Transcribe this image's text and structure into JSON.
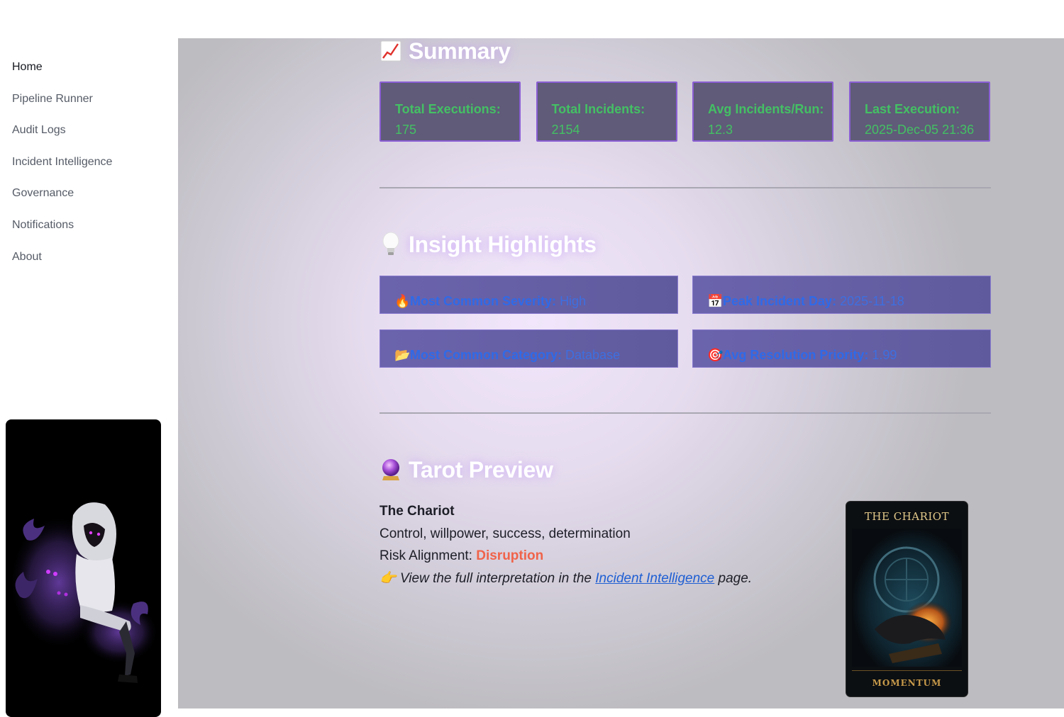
{
  "sidebar": {
    "items": [
      {
        "label": "Home",
        "active": true
      },
      {
        "label": "Pipeline Runner"
      },
      {
        "label": "Audit Logs"
      },
      {
        "label": "Incident Intelligence"
      },
      {
        "label": "Governance"
      },
      {
        "label": "Notifications"
      },
      {
        "label": "About"
      }
    ]
  },
  "summary": {
    "title": "Summary",
    "icon": "chart-increasing-icon",
    "metrics": [
      {
        "label": "Total Executions:",
        "value": "175"
      },
      {
        "label": "Total Incidents:",
        "value": "2154"
      },
      {
        "label": "Avg Incidents/Run:",
        "value": "12.3"
      },
      {
        "label": "Last Execution:",
        "value": "2025-Dec-05 21:36"
      }
    ]
  },
  "insights": {
    "title": "Insight Highlights",
    "icon": "light-bulb-icon",
    "items": [
      {
        "icon": "fire-icon",
        "key": "Most Common Severity:",
        "value": "High"
      },
      {
        "icon": "calendar-icon",
        "key": "Peak Incident Day:",
        "value": "2025-11-18"
      },
      {
        "icon": "folder-icon",
        "key": "Most Common Category:",
        "value": "Database"
      },
      {
        "icon": "target-icon",
        "key": "Avg Resolution Priority:",
        "value": "1.99"
      }
    ]
  },
  "tarot": {
    "title": "Tarot Preview",
    "icon": "crystal-ball-icon",
    "card_name": "The Chariot",
    "meaning": "Control, willpower, success, determination",
    "risk_label": "Risk Alignment:",
    "risk_value": "Disruption",
    "note_prefix": "View the full interpretation in the",
    "note_link": "Incident Intelligence",
    "note_suffix": "page.",
    "card_title": "THE CHARIOT",
    "card_footer": "MOMENTUM"
  },
  "colors": {
    "metric_text": "#44c064",
    "insight_text": "#2f6ae8",
    "risk": "#f0634a",
    "link": "#1f5fd3"
  }
}
